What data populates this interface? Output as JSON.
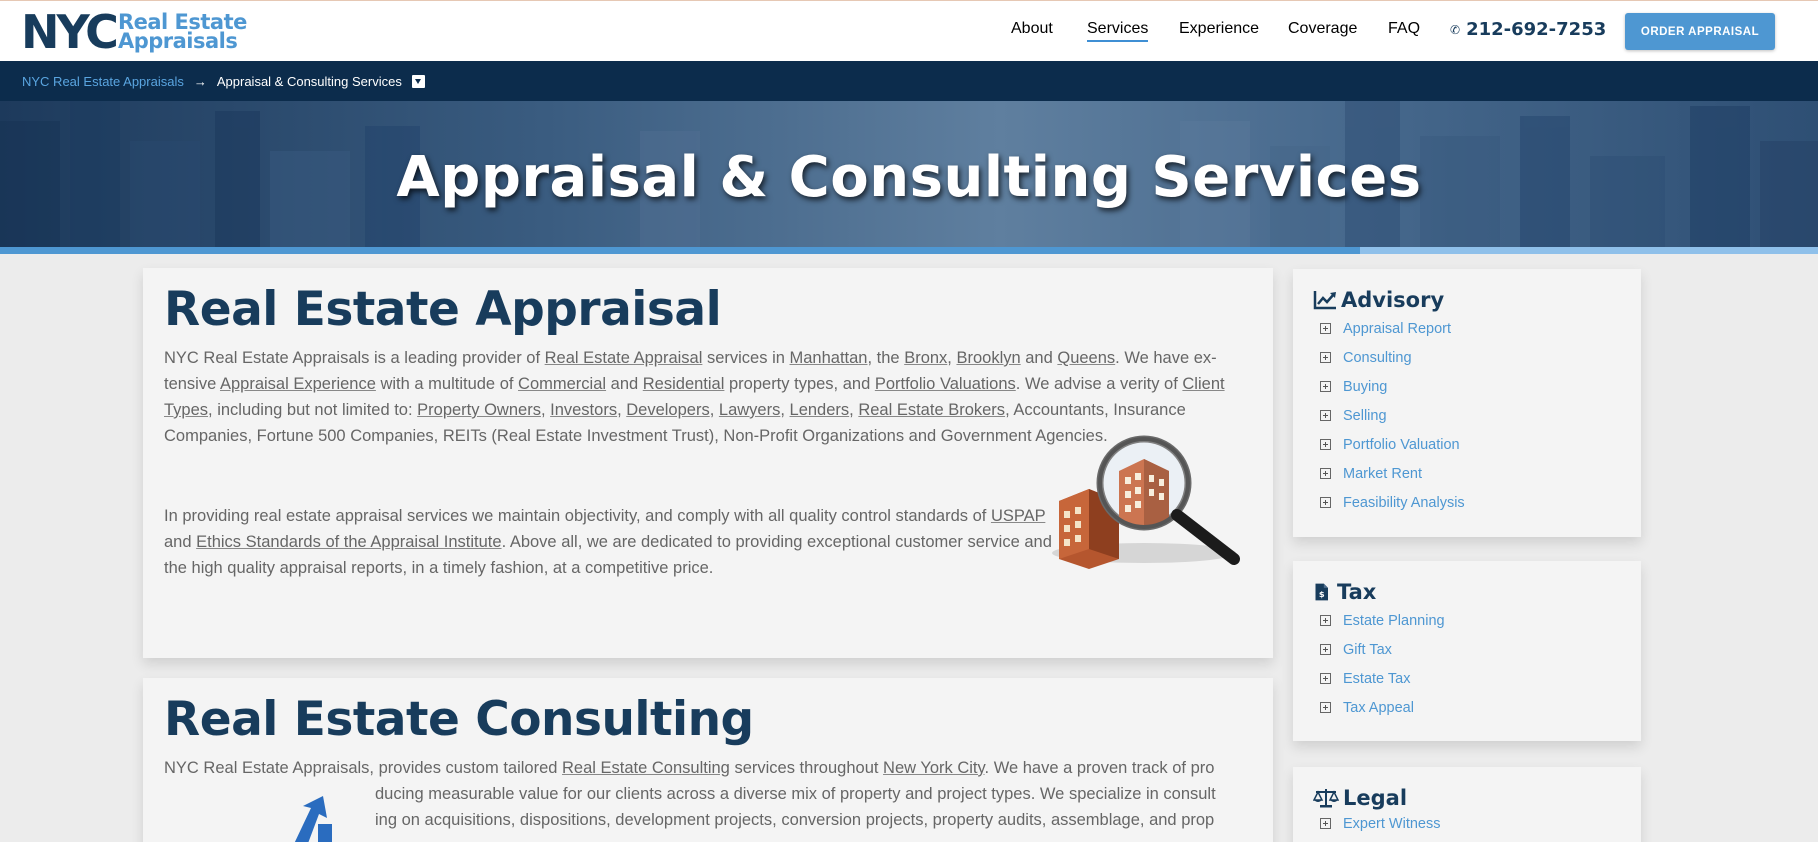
{
  "header": {
    "logo_nyc": "NYC",
    "logo_line1": "Real Estate",
    "logo_line2": "Appraisals",
    "nav": [
      {
        "label": "About",
        "active": false
      },
      {
        "label": "Services",
        "active": true
      },
      {
        "label": "Experience",
        "active": false
      },
      {
        "label": "Coverage",
        "active": false
      },
      {
        "label": "FAQ",
        "active": false
      }
    ],
    "phone": "212-692-7253",
    "order_button": "ORDER APPRAISAL"
  },
  "breadcrumb": {
    "home": "NYC Real Estate Appraisals",
    "separator": "→",
    "current": "Appraisal & Consulting Services"
  },
  "hero": {
    "title": "Appraisal & Consulting Services"
  },
  "appraisal": {
    "title": "Real Estate Appraisal",
    "p1_parts": [
      {
        "t": "NYC Real Estate Appraisals is a leading provider of "
      },
      {
        "t": "Real Estate Appraisal",
        "link": true
      },
      {
        "t": " services in "
      },
      {
        "t": "Manhattan",
        "link": true
      },
      {
        "t": ", the "
      },
      {
        "t": "Bronx",
        "link": true
      },
      {
        "t": ", "
      },
      {
        "t": "Brooklyn",
        "link": true
      },
      {
        "t": " and "
      },
      {
        "t": "Queens",
        "link": true
      },
      {
        "t": ". We have ex­tensive "
      },
      {
        "t": "Appraisal Experience",
        "link": true
      },
      {
        "t": " with a multitude of "
      },
      {
        "t": "Commercial",
        "link": true
      },
      {
        "t": " and "
      },
      {
        "t": "Residential",
        "link": true
      },
      {
        "t": " property types, and "
      },
      {
        "t": "Portfolio Valuations",
        "link": true
      },
      {
        "t": ". We advise a verity of "
      },
      {
        "t": "Client Types",
        "link": true
      },
      {
        "t": ", including but not limited to: "
      },
      {
        "t": "Property Owners",
        "link": true
      },
      {
        "t": ", "
      },
      {
        "t": "Investors",
        "link": true
      },
      {
        "t": ", "
      },
      {
        "t": "Developers",
        "link": true
      },
      {
        "t": ", "
      },
      {
        "t": "Lawyers",
        "link": true
      },
      {
        "t": ", "
      },
      {
        "t": "Lenders",
        "link": true
      },
      {
        "t": ", "
      },
      {
        "t": "Real Estate Brokers",
        "link": true
      },
      {
        "t": ", Accountants, Insurance Companies, Fortune 500 Companies, REITs (Real Estate Investment Trust), Non-Profit Organizations and Government Agencies."
      }
    ],
    "p2_parts": [
      {
        "t": "In providing real estate appraisal services we maintain objectivity, and comply with all quality control standards of "
      },
      {
        "t": "USPAP",
        "link": true
      },
      {
        "t": " and "
      },
      {
        "t": "Ethics Standards of the Appraisal Institute",
        "link": true
      },
      {
        "t": ". Above all, we are dedicated to providing exceptional customer service and the high quality appraisal reports, in a timely fashion, at a competitive price."
      }
    ]
  },
  "consulting": {
    "title": "Real Estate Consulting",
    "line1_parts": [
      {
        "t": "NYC Real Estate Appraisals, provides custom tailored "
      },
      {
        "t": "Real Estate Consulting",
        "link": true
      },
      {
        "t": " services throughout "
      },
      {
        "t": "New York City",
        "link": true
      },
      {
        "t": ". We have a proven track of pro­"
      }
    ],
    "line2": "ducing measurable value for our clients across a diverse mix of property and project types. We specialize in consult­",
    "line3": "ing on acquisitions, dispositions, development projects, conversion projects, property audits, assemblage, and prop­"
  },
  "sidebar": {
    "advisory": {
      "title": "Advisory",
      "items": [
        "Appraisal Report",
        "Consulting",
        "Buying",
        "Selling",
        "Portfolio Valuation",
        "Market Rent",
        "Feasibility Analysis"
      ]
    },
    "tax": {
      "title": "Tax",
      "items": [
        "Estate Planning",
        "Gift Tax",
        "Estate Tax",
        "Tax Appeal"
      ]
    },
    "legal": {
      "title": "Legal",
      "items": [
        "Expert Witness"
      ]
    }
  },
  "colors": {
    "navy": "#183c5c",
    "accent_blue": "#4e97d2",
    "breadcrumb_bg": "#0c2c4c"
  }
}
